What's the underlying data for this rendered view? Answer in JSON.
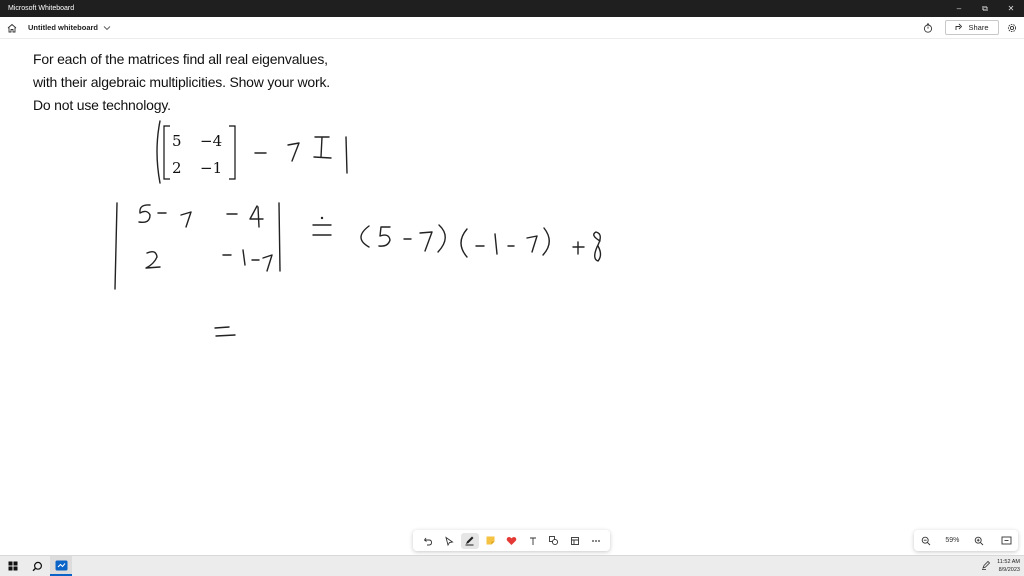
{
  "window": {
    "title": "Microsoft Whiteboard"
  },
  "appbar": {
    "board_name": "Untitled whiteboard",
    "share_label": "Share"
  },
  "canvas": {
    "prompt_lines": [
      "For each of the matrices find all real eigenvalues,",
      "with their algebraic multiplicities. Show your work.",
      "Do not use technology."
    ],
    "matrix": {
      "r1c1": "5",
      "r1c2": "−4",
      "r2c1": "2",
      "r2c2": "−1"
    }
  },
  "toolbar": {
    "tools": [
      "undo-icon",
      "select-icon",
      "pen-icon",
      "sticky-note-icon",
      "reaction-icon",
      "text-icon",
      "shapes-icon",
      "templates-icon",
      "more-icon"
    ],
    "active_tool": "pen-icon"
  },
  "zoom": {
    "level": "59%"
  },
  "taskbar": {
    "time": "11:52 AM",
    "date": "8/9/2023"
  },
  "colors": {
    "titlebar": "#1f1f1f",
    "ink": "#222222",
    "heart": "#e53935",
    "sticky": "#f5c242",
    "accent": "#0a64c8"
  }
}
